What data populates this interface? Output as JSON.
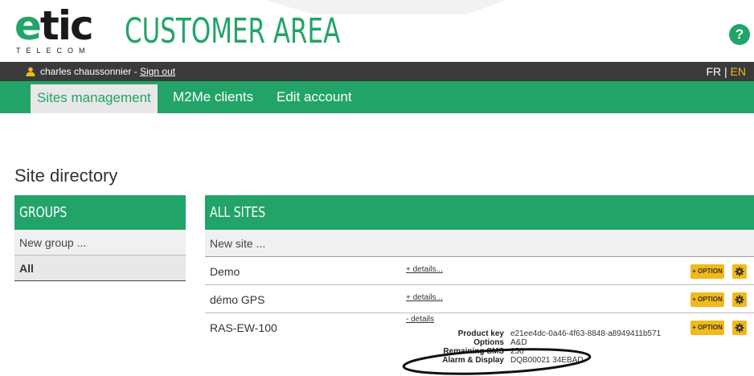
{
  "header": {
    "logo_main_e": "e",
    "logo_main_rest": "tic",
    "logo_sub": "TELECOM",
    "area_title": "CUSTOMER AREA",
    "help_label": "?"
  },
  "userbar": {
    "user_name": "charles chaussonnier - ",
    "signout_label": "Sign out",
    "lang_fr": "FR",
    "lang_sep": " | ",
    "lang_en": "EN"
  },
  "nav": {
    "tabs": [
      {
        "label": "Sites management",
        "active": true
      },
      {
        "label": "M2Me clients",
        "active": false
      },
      {
        "label": "Edit account",
        "active": false
      }
    ]
  },
  "page_title": "Site directory",
  "groups": {
    "header": "GROUPS",
    "new_label": "New group ...",
    "items": [
      "All"
    ]
  },
  "sites": {
    "header": "ALL SITES",
    "new_label": "New site ...",
    "rows": [
      {
        "name": "Demo",
        "details_label": "+ details...",
        "option_label": "+ OPTION"
      },
      {
        "name": "démo GPS",
        "details_label": "+ details...",
        "option_label": "+ OPTION"
      },
      {
        "name": "RAS-EW-100",
        "details_label": "- details",
        "option_label": "+ OPTION"
      }
    ],
    "expanded_details": [
      {
        "key": "Product key",
        "value": "e21ee4dc-0a46-4f63-8848-a8949411b571"
      },
      {
        "key": "Options",
        "value": "A&D"
      },
      {
        "key": "Remaining SMS",
        "value": "250"
      },
      {
        "key": "Alarm & Display",
        "value": "DQB00021 34EBAD"
      }
    ]
  },
  "colors": {
    "brand_green": "#22a468",
    "dark_bar": "#3a3a3a",
    "accent_yellow": "#f2b91a"
  }
}
